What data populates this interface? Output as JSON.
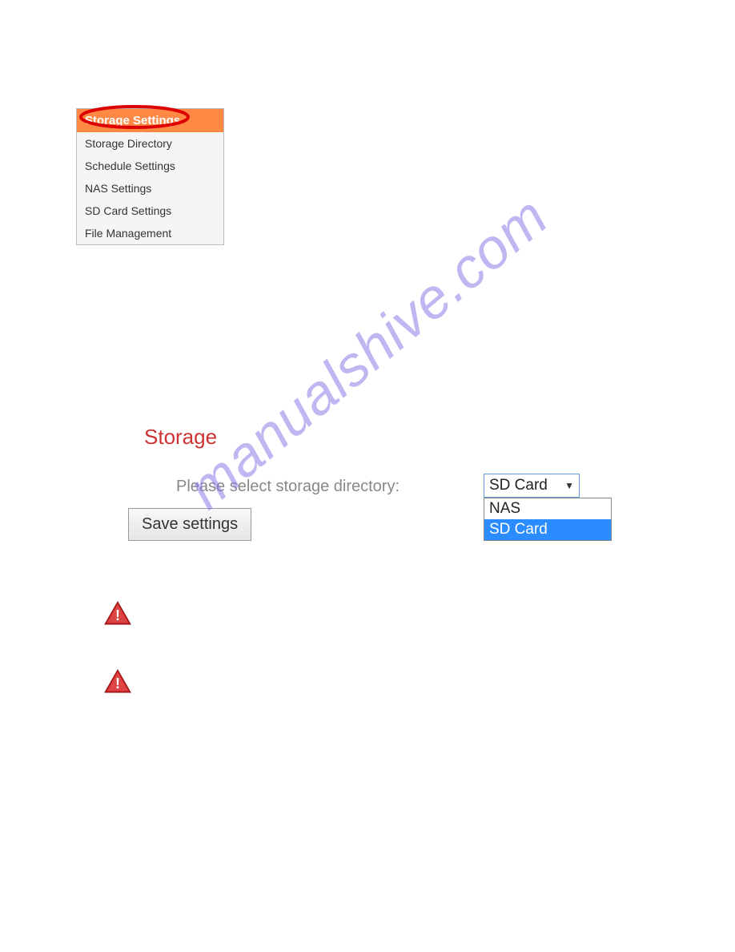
{
  "watermark": "manualshive.com",
  "sidebar": {
    "header": "Storage Settings",
    "items": [
      "Storage Directory",
      "Schedule Settings",
      "NAS Settings",
      "SD Card Settings",
      "File Management"
    ]
  },
  "storage": {
    "title": "Storage",
    "select_label": "Please select storage directory:",
    "save_button": "Save settings"
  },
  "select": {
    "current": "SD Card",
    "options": [
      "NAS",
      "SD Card"
    ]
  }
}
